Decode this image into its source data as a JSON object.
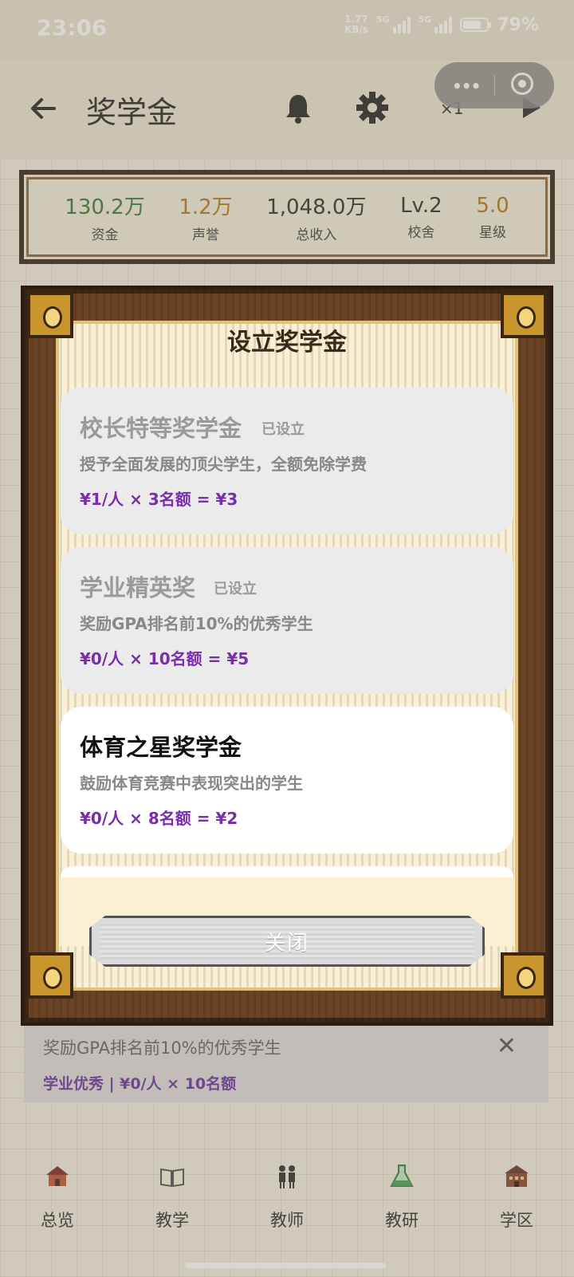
{
  "status_bar": {
    "time": "23:06",
    "speed_value": "1.77",
    "speed_unit": "KB/s",
    "net1": "5G",
    "net2": "5G",
    "battery": "79%",
    "battery_level": 0.79
  },
  "header": {
    "title": "奖学金",
    "speed_label": "×1",
    "icons": [
      "back-arrow-icon",
      "bell-icon",
      "gear-icon",
      "play-icon",
      "more-dots-icon",
      "record-icon"
    ]
  },
  "stats": [
    {
      "value": "130.2万",
      "label": "资金",
      "color": "#3f7a3a"
    },
    {
      "value": "1.2万",
      "label": "声誉",
      "color": "#b5781e"
    },
    {
      "value": "1,048.0万",
      "label": "总收入",
      "color": "#333333"
    },
    {
      "value": "Lv.2",
      "label": "校舍",
      "color": "#333333"
    },
    {
      "value": "5.0",
      "label": "星级",
      "color": "#b5781e"
    }
  ],
  "modal": {
    "title": "设立奖学金",
    "cards": [
      {
        "name": "校长特等奖学金",
        "badge": "已设立",
        "desc": "授予全面发展的顶尖学生，全额免除学费",
        "cost": "¥1/人 × 3名额 = ¥3"
      },
      {
        "name": "学业精英奖",
        "badge": "已设立",
        "desc": "奖励GPA排名前10%的优秀学生",
        "cost": "¥0/人 × 10名额 = ¥5"
      },
      {
        "name": "体育之星奖学金",
        "desc": "鼓励体育竞赛中表现突出的学生",
        "cost": "¥0/人 × 8名额 = ¥2"
      }
    ],
    "close_label": "关闭"
  },
  "tip": {
    "text": "奖励GPA排名前10%的优秀学生",
    "sub": "学业优秀 | ¥0/人 × 10名额",
    "close_icon": "close-icon"
  },
  "bottom_nav": [
    {
      "label": "总览",
      "icon": "school-house-icon"
    },
    {
      "label": "教学",
      "icon": "open-book-icon"
    },
    {
      "label": "教师",
      "icon": "teachers-icon"
    },
    {
      "label": "教研",
      "icon": "flask-icon"
    },
    {
      "label": "学区",
      "icon": "building-icon"
    }
  ],
  "colors": {
    "accent_purple": "#7a2ea8",
    "frame_wood": "#6b4426",
    "frame_gold": "#c9962e"
  }
}
